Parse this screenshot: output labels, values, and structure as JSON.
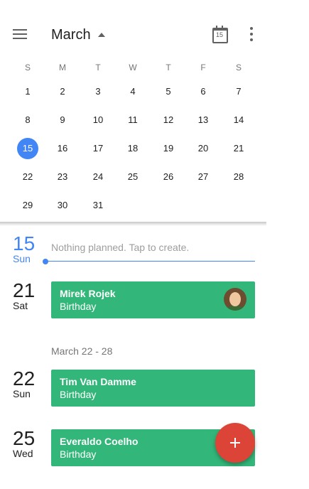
{
  "header": {
    "month": "March",
    "today_icon_day": "15"
  },
  "calendar": {
    "weekdays": [
      "S",
      "M",
      "T",
      "W",
      "T",
      "F",
      "S"
    ],
    "weeks": [
      [
        "1",
        "2",
        "3",
        "4",
        "5",
        "6",
        "7"
      ],
      [
        "8",
        "9",
        "10",
        "11",
        "12",
        "13",
        "14"
      ],
      [
        "15",
        "16",
        "17",
        "18",
        "19",
        "20",
        "21"
      ],
      [
        "22",
        "23",
        "24",
        "25",
        "26",
        "27",
        "28"
      ],
      [
        "29",
        "30",
        "31",
        "",
        "",
        "",
        ""
      ]
    ],
    "selected_day": "15"
  },
  "agenda": {
    "today": {
      "day": "15",
      "weekday": "Sun",
      "empty_text": "Nothing planned. Tap to create."
    },
    "entries": [
      {
        "day": "21",
        "weekday": "Sat",
        "title": "Mirek Rojek",
        "subtitle": "Birthday"
      },
      {
        "day": "22",
        "weekday": "Sun",
        "title": "Tim Van Damme",
        "subtitle": "Birthday"
      },
      {
        "day": "25",
        "weekday": "Wed",
        "title": "Everaldo Coelho",
        "subtitle": "Birthday"
      }
    ],
    "week_range": "March 22 - 28"
  },
  "colors": {
    "accent_blue": "#4285f4",
    "event_green": "#33b679",
    "fab_red": "#db4437"
  },
  "icons": {
    "menu": "menu-icon",
    "caret": "caret-up-icon",
    "today": "calendar-today-icon",
    "more": "more-vert-icon",
    "fab": "add-icon"
  }
}
